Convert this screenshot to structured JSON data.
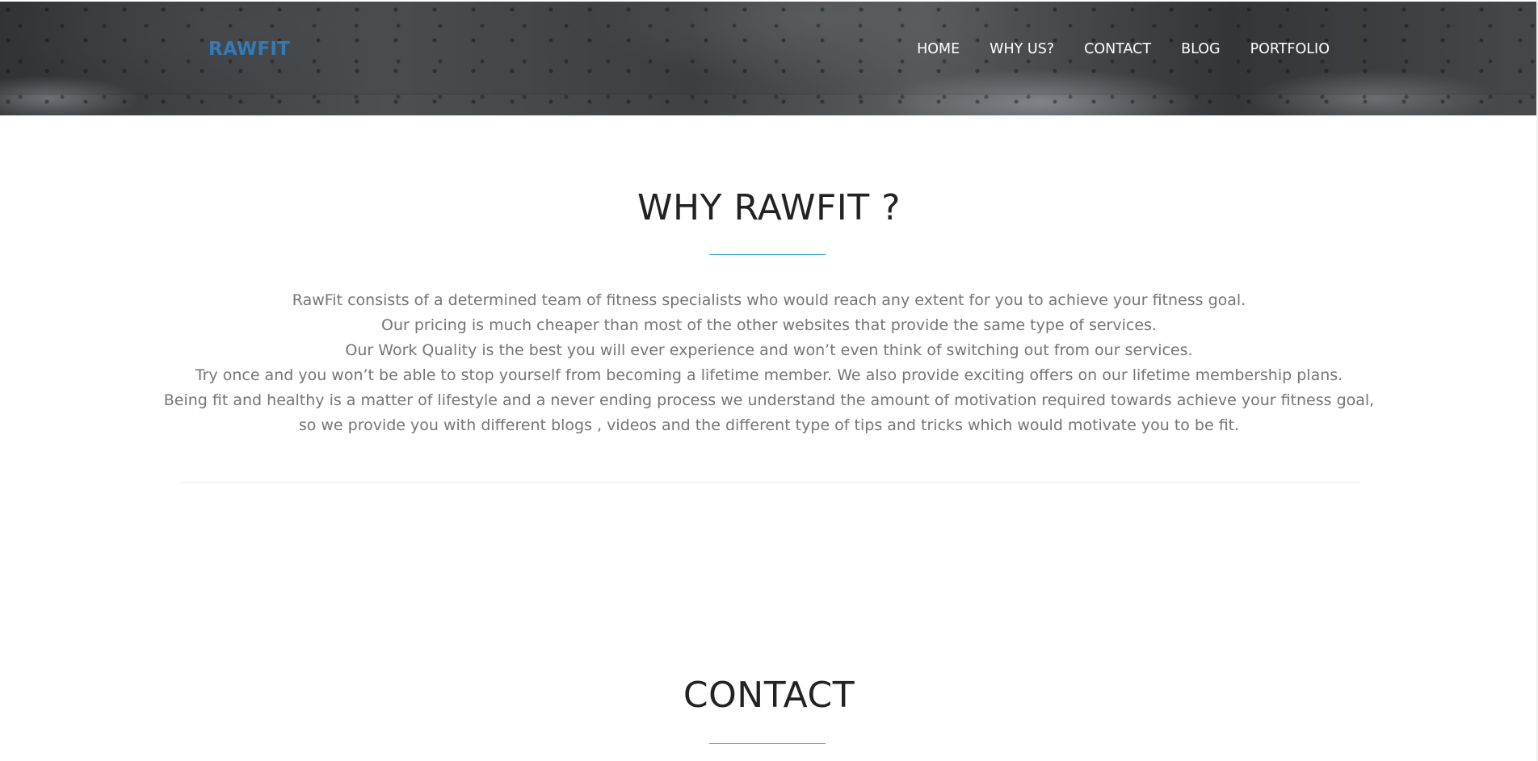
{
  "header": {
    "brand": "RAWFIT",
    "nav": [
      "HOME",
      "WHY US?",
      "CONTACT",
      "BLOG",
      "PORTFOLIO"
    ]
  },
  "why_section": {
    "title": "WHY RAWFIT ?",
    "lines": [
      "RawFit consists of a determined team of fitness specialists who would reach any extent for you to achieve your fitness goal.",
      "Our pricing is much cheaper than most of the other websites that provide the same type of services.",
      "Our Work Quality is the best you will ever experience and won’t even think of switching out from our services.",
      "Try once and you won’t be able to stop yourself from becoming a lifetime member. We also provide exciting offers on our lifetime membership plans.",
      "Being fit and healthy is a matter of lifestyle and a never ending process we understand the amount of motivation required towards achieve your fitness goal,",
      "so we provide you with different blogs , videos and the different type of tips and tricks which would motivate you to be fit."
    ]
  },
  "contact_section": {
    "title": "CONTACT"
  },
  "colors": {
    "brand": "#337ab7",
    "accent_rule": "#2fa4d7",
    "body_text": "#757575",
    "heading": "#222222"
  }
}
